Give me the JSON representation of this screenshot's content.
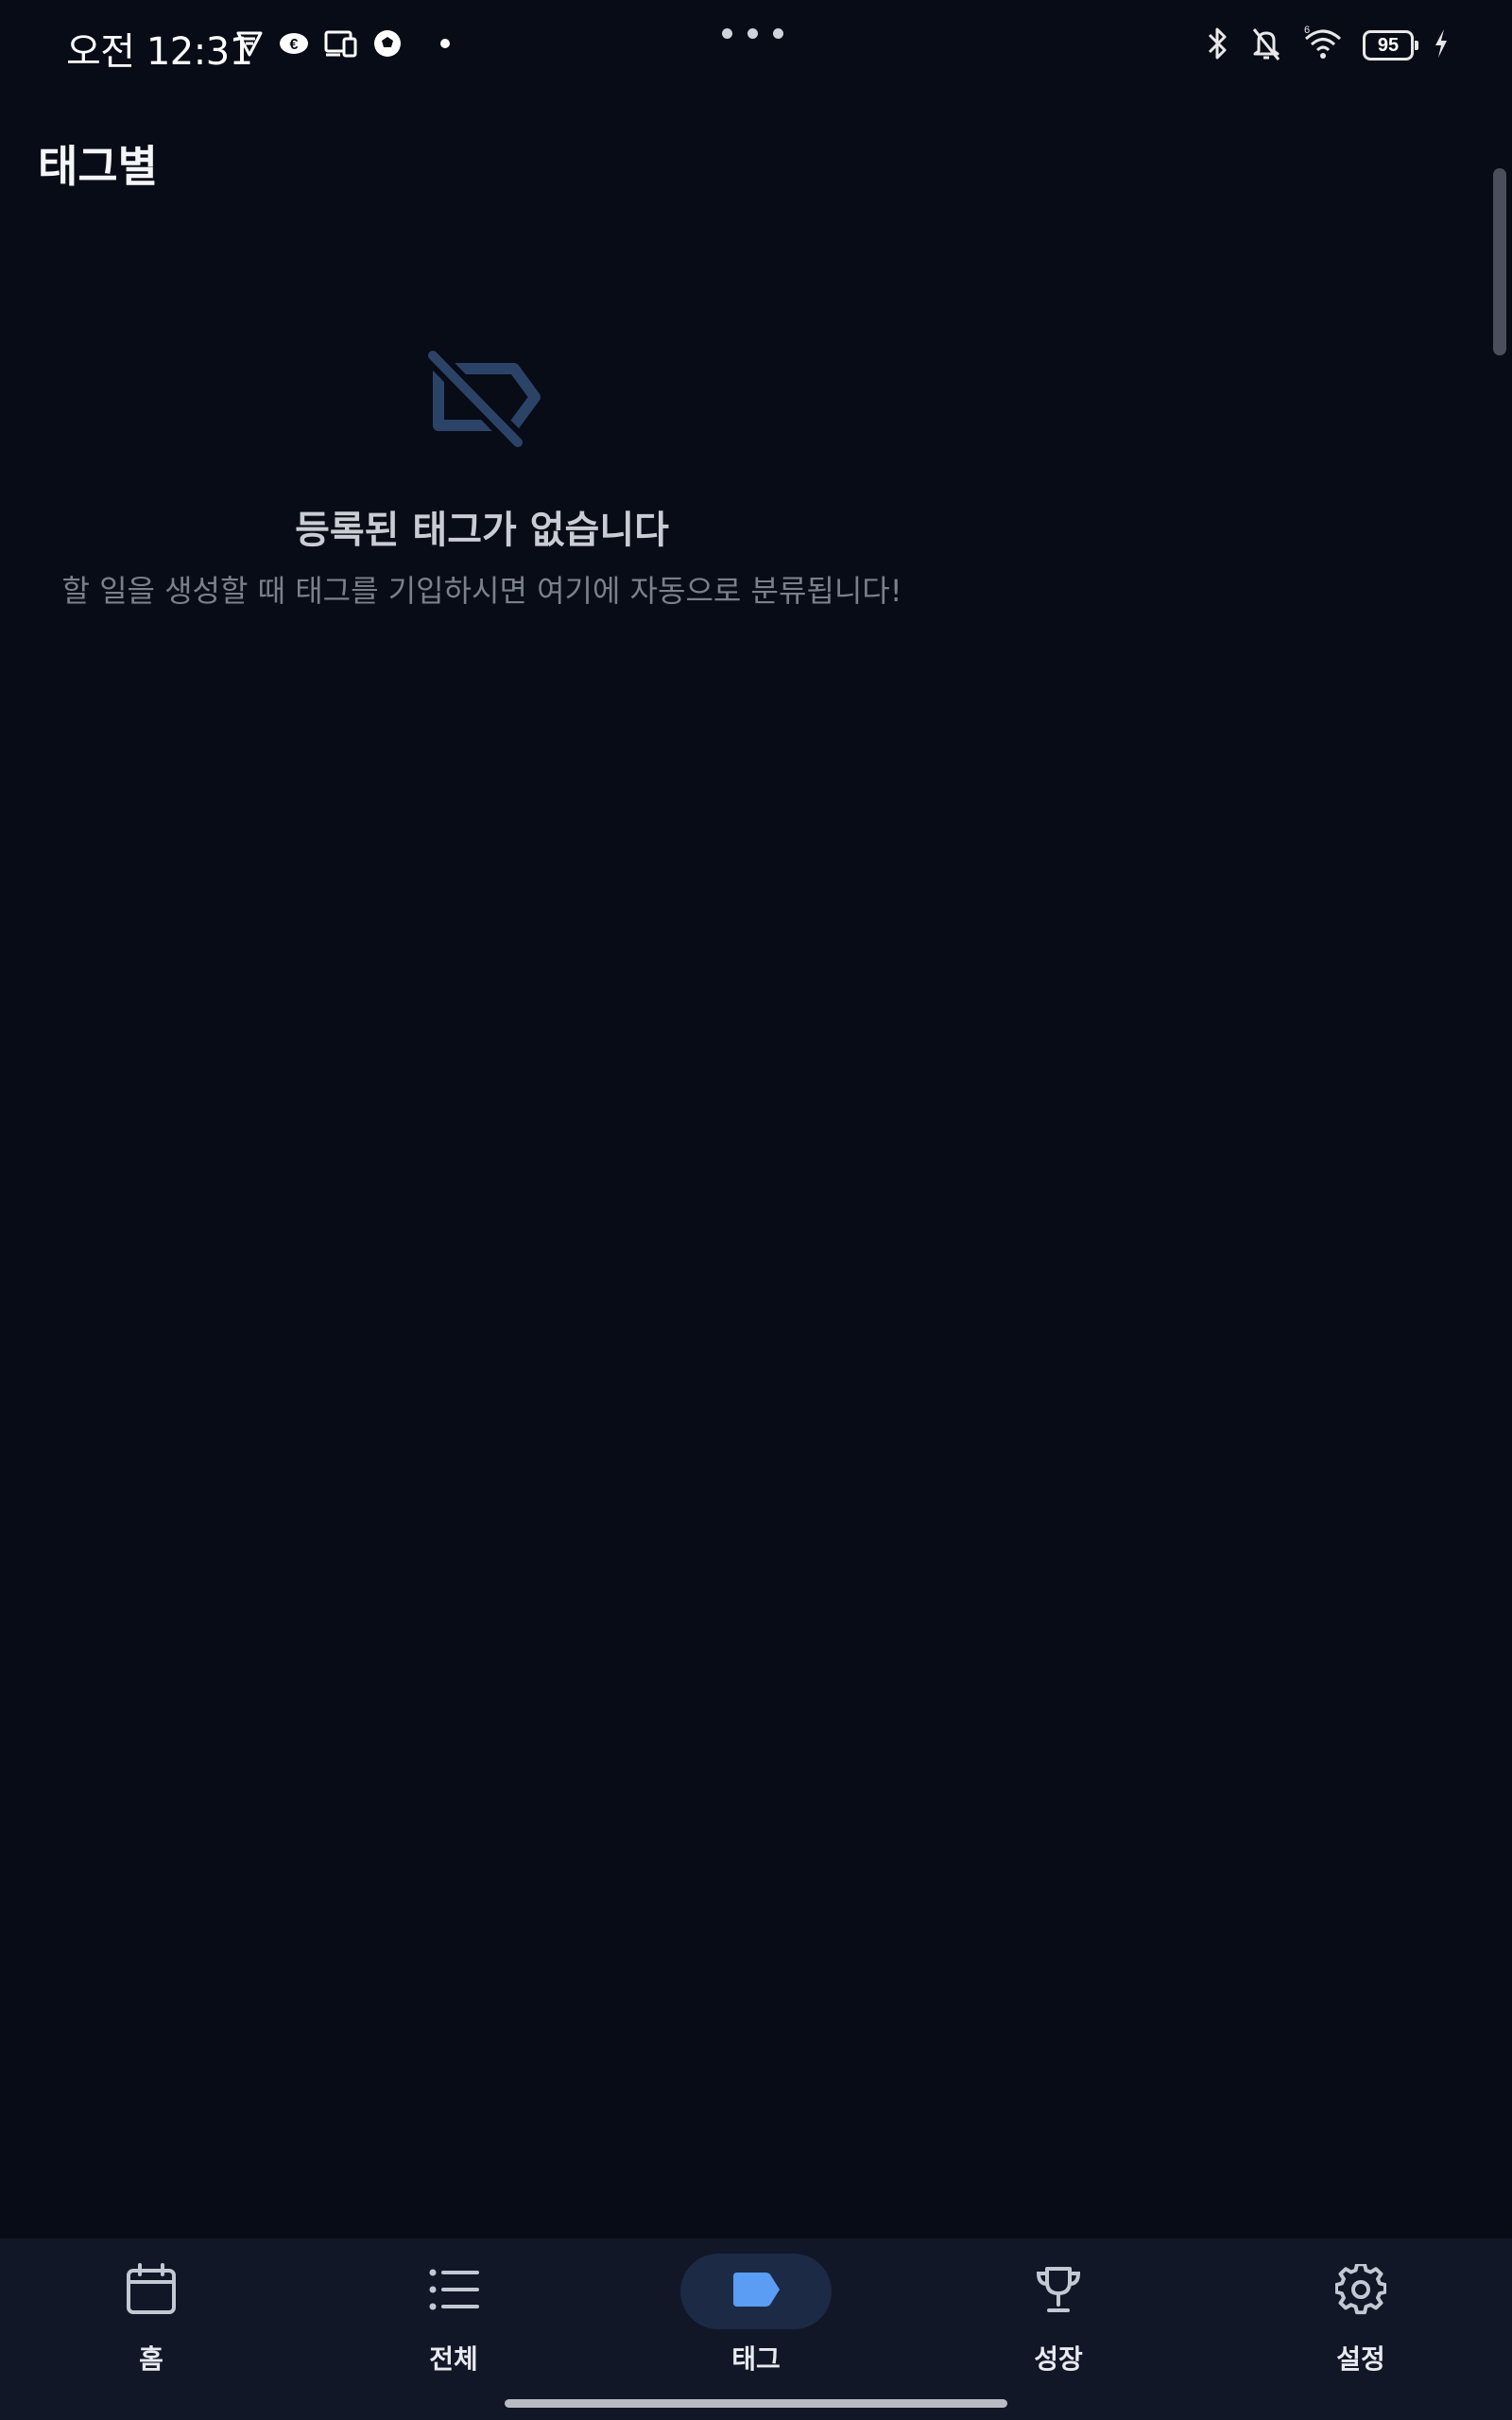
{
  "status_bar": {
    "time": "오전 12:31",
    "battery": "95",
    "icons": [
      "vpn-icon",
      "app-icon",
      "cast-icon",
      "soccer-icon",
      "bluetooth-icon",
      "mute-icon",
      "wifi-icon",
      "battery-icon",
      "charging-icon"
    ]
  },
  "header": {
    "title": "태그별"
  },
  "empty_state": {
    "icon": "tag-off-icon",
    "title": "등록된 태그가 없습니다",
    "subtitle": "할 일을 생성할 때 태그를 기입하시면 여기에 자동으로 분류됩니다!"
  },
  "bottom_nav": {
    "active": "태그",
    "accent": "#5b9cf5",
    "items": [
      {
        "label": "홈",
        "icon": "calendar-icon"
      },
      {
        "label": "전체",
        "icon": "list-icon"
      },
      {
        "label": "태그",
        "icon": "tag-icon"
      },
      {
        "label": "성장",
        "icon": "trophy-icon"
      },
      {
        "label": "설정",
        "icon": "gear-icon"
      }
    ]
  }
}
